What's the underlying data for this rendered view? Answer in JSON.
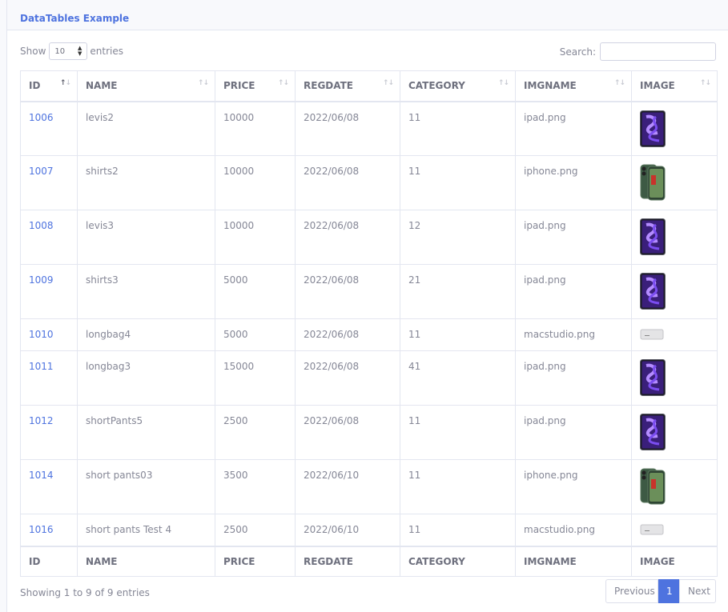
{
  "card": {
    "title": "DataTables Example"
  },
  "controls": {
    "show_label": "Show",
    "entries_label": "entries",
    "length_value": "10",
    "search_label": "Search:"
  },
  "table": {
    "columns": [
      "ID",
      "NAME",
      "PRICE",
      "REGDATE",
      "CATEGORY",
      "IMGNAME",
      "IMAGE"
    ],
    "sorted_column": "ID",
    "rows": [
      {
        "id": "1006",
        "name": "levis2",
        "price": "10000",
        "regdate": "2022/06/08",
        "category": "11",
        "imgname": "ipad.png",
        "image": "ipad-image"
      },
      {
        "id": "1007",
        "name": "shirts2",
        "price": "10000",
        "regdate": "2022/06/08",
        "category": "11",
        "imgname": "iphone.png",
        "image": "iphone-image"
      },
      {
        "id": "1008",
        "name": "levis3",
        "price": "10000",
        "regdate": "2022/06/08",
        "category": "12",
        "imgname": "ipad.png",
        "image": "ipad-image"
      },
      {
        "id": "1009",
        "name": "shirts3",
        "price": "5000",
        "regdate": "2022/06/08",
        "category": "21",
        "imgname": "ipad.png",
        "image": "ipad-image"
      },
      {
        "id": "1010",
        "name": "longbag4",
        "price": "5000",
        "regdate": "2022/06/08",
        "category": "11",
        "imgname": "macstudio.png",
        "image": "macstudio-image"
      },
      {
        "id": "1011",
        "name": "longbag3",
        "price": "15000",
        "regdate": "2022/06/08",
        "category": "41",
        "imgname": "ipad.png",
        "image": "ipad-image"
      },
      {
        "id": "1012",
        "name": "shortPants5",
        "price": "2500",
        "regdate": "2022/06/08",
        "category": "11",
        "imgname": "ipad.png",
        "image": "ipad-image"
      },
      {
        "id": "1014",
        "name": "short pants03",
        "price": "3500",
        "regdate": "2022/06/10",
        "category": "11",
        "imgname": "iphone.png",
        "image": "iphone-image"
      },
      {
        "id": "1016",
        "name": "short pants Test 4",
        "price": "2500",
        "regdate": "2022/06/10",
        "category": "11",
        "imgname": "macstudio.png",
        "image": "macstudio-image"
      }
    ]
  },
  "footer": {
    "info": "Showing 1 to 9 of 9 entries",
    "previous_label": "Previous",
    "current_page": "1",
    "next_label": "Next"
  },
  "colors": {
    "accent": "#4e73df",
    "text": "#858796",
    "border": "#e3e6f0"
  }
}
